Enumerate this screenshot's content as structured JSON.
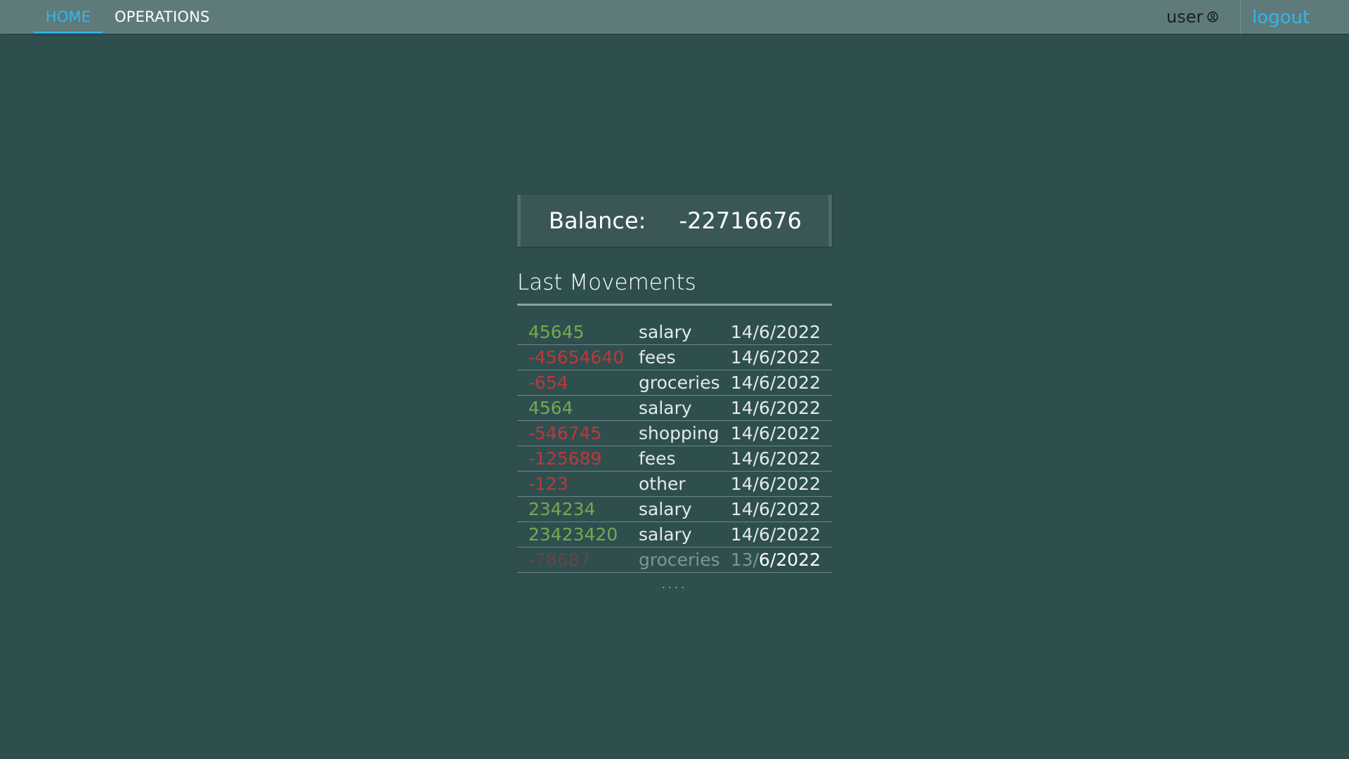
{
  "nav": {
    "home": "HOME",
    "operations": "OPERATIONS",
    "user": "user",
    "logout": "logout"
  },
  "balance": {
    "label": "Balance:",
    "value": "-22716676"
  },
  "movements": {
    "title": "Last Movements",
    "rows": [
      {
        "amount": "45645",
        "category": "salary",
        "date": "14/6/2022",
        "sign": "positive"
      },
      {
        "amount": "-45654640",
        "category": "fees",
        "date": "14/6/2022",
        "sign": "negative"
      },
      {
        "amount": "-654",
        "category": "groceries",
        "date": "14/6/2022",
        "sign": "negative"
      },
      {
        "amount": "4564",
        "category": "salary",
        "date": "14/6/2022",
        "sign": "positive"
      },
      {
        "amount": "-546745",
        "category": "shopping",
        "date": "14/6/2022",
        "sign": "negative"
      },
      {
        "amount": "-125689",
        "category": "fees",
        "date": "14/6/2022",
        "sign": "negative"
      },
      {
        "amount": "-123",
        "category": "other",
        "date": "14/6/2022",
        "sign": "positive_text_negative"
      },
      {
        "amount": "234234",
        "category": "salary",
        "date": "14/6/2022",
        "sign": "positive"
      },
      {
        "amount": "23423420",
        "category": "salary",
        "date": "14/6/2022",
        "sign": "positive"
      },
      {
        "amount": "-78687",
        "category": "groceries",
        "date_head": "13/",
        "date_tail": "6/2022",
        "sign": "negative"
      }
    ],
    "more": "...."
  },
  "colors": {
    "background": "#2f4f4f",
    "navbar": "#5f7a7a",
    "accent": "#2eb8ef",
    "positive": "#79a84e",
    "negative": "#c0363a"
  }
}
